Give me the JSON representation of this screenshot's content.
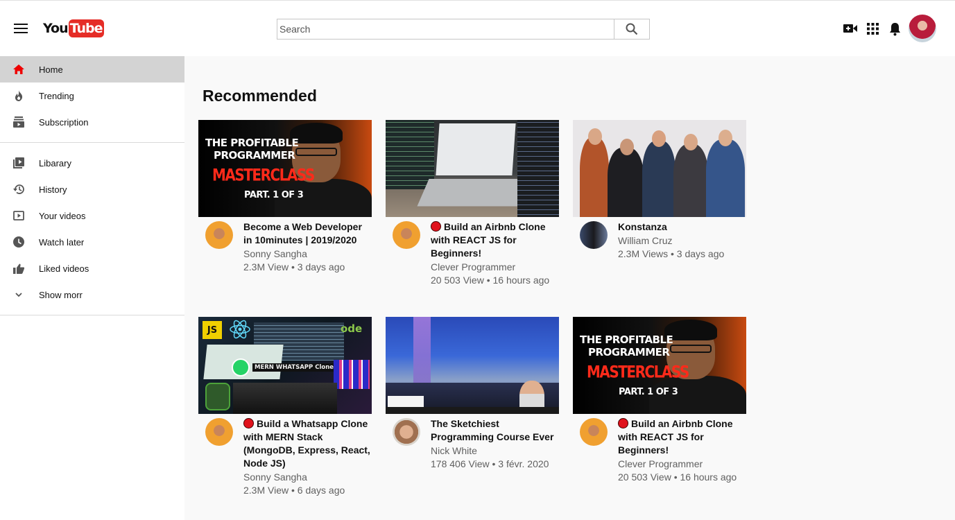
{
  "header": {
    "logo_you": "You",
    "logo_tube": "Tube",
    "search_placeholder": "Search"
  },
  "sidebar": {
    "primary": [
      {
        "label": "Home",
        "icon": "home-icon",
        "active": true
      },
      {
        "label": "Trending",
        "icon": "trending-icon"
      },
      {
        "label": "Subscription",
        "icon": "subscription-icon"
      }
    ],
    "secondary": [
      {
        "label": "Libarary",
        "icon": "library-icon"
      },
      {
        "label": "History",
        "icon": "history-icon"
      },
      {
        "label": "Your videos",
        "icon": "your-videos-icon"
      },
      {
        "label": "Watch later",
        "icon": "watch-later-icon"
      },
      {
        "label": "Liked videos",
        "icon": "liked-icon"
      },
      {
        "label": "Show morr",
        "icon": "chevron-down-icon"
      }
    ]
  },
  "main": {
    "title": "Recommended",
    "videos": [
      {
        "title": "Become a Web Developer in 10minutes | 2019/2020",
        "channel": "Sonny Sangha",
        "stats": "2.3M View • 3 days ago",
        "live": false
      },
      {
        "title": "Build an Airbnb Clone with REACT JS for Beginners!",
        "channel": "Clever Programmer",
        "stats": "20 503 View • 16 hours ago",
        "live": true
      },
      {
        "title": "Konstanza",
        "channel": "William Cruz",
        "stats": "2.3M Views • 3 days ago",
        "live": false
      },
      {
        "title": "Build a Whatsapp Clone with MERN Stack (MongoDB, Express, React, Node JS)",
        "channel": "Sonny Sangha",
        "stats": "2.3M View • 6 days ago",
        "live": true
      },
      {
        "title": "The Sketchiest Programming Course Ever",
        "channel": "Nick White",
        "stats": "178 406 View • 3 févr. 2020",
        "live": false
      },
      {
        "title": "Build an Airbnb Clone with REACT JS for Beginners!",
        "channel": "Clever Programmer",
        "stats": "20 503 View • 16 hours ago",
        "live": true
      }
    ],
    "thumbnails": {
      "profitable_line1": "THE PROFITABLE",
      "profitable_line2": "PROGRAMMER",
      "profitable_line3": "MASTERCLASS",
      "profitable_line4": "PART. 1 OF 3",
      "whatsapp_badge": "JS",
      "whatsapp_text": "MERN WHATSAPP Clone",
      "whatsapp_node": "ode"
    }
  },
  "colors": {
    "brand_red": "#e52d27",
    "active_bg": "#d3d3d3",
    "meta_gray": "#606060",
    "live_red": "#e0121c"
  }
}
